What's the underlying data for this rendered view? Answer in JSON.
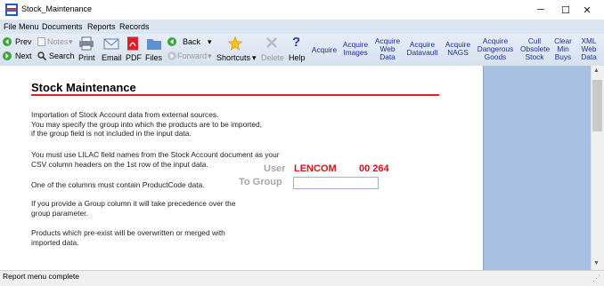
{
  "window": {
    "title": "Stock_Maintenance",
    "controls": {
      "minimize": "─",
      "maximize": "☐",
      "close": "✕"
    }
  },
  "menu": {
    "items": [
      "File Menu",
      "Documents",
      "Reports",
      "Records"
    ]
  },
  "toolbar": {
    "row1": {
      "prev": "Prev",
      "notes": "Notes",
      "back": "Back"
    },
    "row2": {
      "next": "Next",
      "search": "Search",
      "forward": "Forward"
    },
    "print": "Print",
    "email": "Email",
    "pdf": "PDF",
    "files": "Files",
    "shortcuts": "Shortcuts",
    "delete": "Delete",
    "help": "Help",
    "acquire": "Acquire",
    "acquire_images": [
      "Acquire",
      "Images"
    ],
    "acquire_web_data": [
      "Acquire",
      "Web",
      "Data"
    ],
    "acquire_datavault": [
      "Acquire",
      "Datavault"
    ],
    "acquire_nags": [
      "Acquire",
      "NAGS"
    ],
    "acquire_dangerous_goods": [
      "Acquire",
      "Dangerous",
      "Goods"
    ],
    "cull_obsolete_stock": [
      "Cull",
      "Obsolete",
      "Stock"
    ],
    "clear_min_buys": [
      "Clear",
      "Min",
      "Buys"
    ],
    "xml_web_data": [
      "XML",
      "Web",
      "Data"
    ]
  },
  "main": {
    "heading": "Stock Maintenance",
    "paragraphs": [
      [
        "Importation of Stock Account data from external sources.",
        "You may specify the group into which the products are to be imported,",
        "if the group field is not included in the input data."
      ],
      [
        "You must use LILAC field names from the Stock Account document as your",
        "CSV column headers on the 1st row of the input data."
      ],
      [
        "One of the columns must contain ProductCode data."
      ],
      [
        "If you provide a Group column it will take precedence over the",
        "group parameter."
      ],
      [
        "Products which pre-exist will be overwritten or merged with",
        "imported data."
      ]
    ],
    "user_label": "User",
    "user_value": "LENCOM",
    "user_code": "00 264",
    "group_label": "To Group",
    "group_value": ""
  },
  "status": {
    "text": "Report menu complete"
  },
  "colors": {
    "accent_red": "#d0121b",
    "rule_red": "#e02020",
    "side_panel": "#a9c1e0",
    "toolbar": "#dbe5f1"
  }
}
